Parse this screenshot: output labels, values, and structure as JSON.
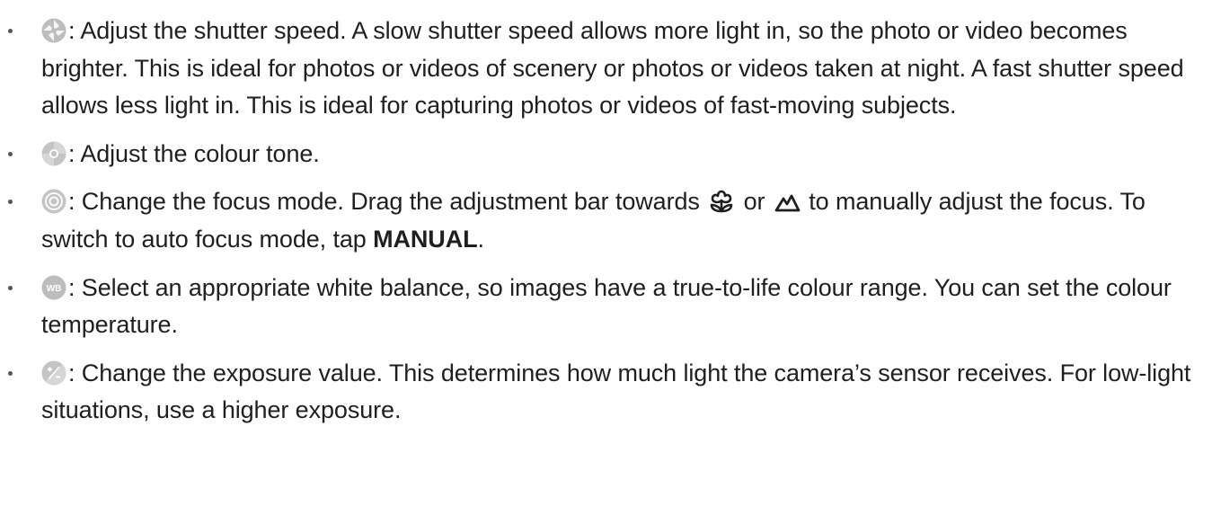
{
  "items": [
    {
      "icon": "shutter-speed-icon",
      "text": ": Adjust the shutter speed. A slow shutter speed allows more light in, so the photo or video becomes brighter. This is ideal for photos or videos of scenery or photos or videos taken at night. A fast shutter speed allows less light in. This is ideal for capturing photos or videos of fast-moving subjects."
    },
    {
      "icon": "colour-tone-icon",
      "text": ": Adjust the colour tone."
    },
    {
      "icon": "focus-mode-icon",
      "text_before": ": Change the focus mode. Drag the adjustment bar towards",
      "macro_icon": "flower-macro-icon",
      "text_or": "or",
      "landscape_icon": "mountain-landscape-icon",
      "text_after": "to manually adjust the focus. To switch to auto focus mode, tap",
      "emphasis": "MANUAL",
      "period": "."
    },
    {
      "icon": "white-balance-icon",
      "icon_label": "WB",
      "text": ": Select an appropriate white balance, so images have a true-to-life colour range. You can set the colour temperature."
    },
    {
      "icon": "exposure-value-icon",
      "text": ": Change the exposure value. This determines how much light the camera’s sensor receives. For low-light situations, use a higher exposure."
    }
  ],
  "colors": {
    "text": "#1f1f1f",
    "icon_grey": "#b8b8b8",
    "bullet": "#555555"
  }
}
